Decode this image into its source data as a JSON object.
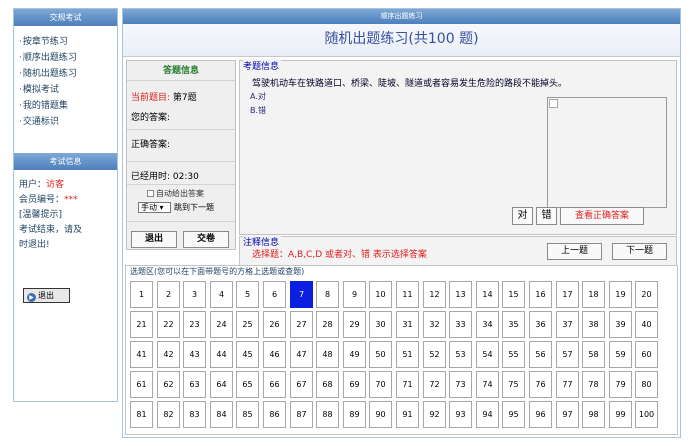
{
  "left": {
    "exam_header": "交规考试",
    "nav_items": [
      {
        "label": "按章节练习"
      },
      {
        "label": "顺序出题练习"
      },
      {
        "label": "随机出题练习"
      },
      {
        "label": "模拟考试"
      },
      {
        "label": "我的错题集"
      },
      {
        "label": "交通标识"
      }
    ],
    "info_header": "考试信息",
    "user_label": "用户：",
    "user_value": "访客",
    "member_label": "会员编号：",
    "member_value": "***",
    "tip_label": "[温馨提示]",
    "tip_text_1": "考试结束，请及",
    "tip_text_2": "时退出!",
    "exit_label": "退出"
  },
  "main": {
    "header": "顺序出题练习",
    "title": "随机出题练习(共100  题)",
    "answer_panel": {
      "title": "答题信息",
      "current_label": "当前题目:",
      "current_value": "第7题",
      "your_answer_label": "您的答案:",
      "your_answer_value": "",
      "correct_label": "正确答案:",
      "correct_value": "",
      "time_label": "已经用时:",
      "time_value": "02:30",
      "auto_answer_label": "自动给出答案",
      "mode_value": "手动",
      "jump_label": "跳到下一题",
      "exit_label": "退出",
      "submit_label": "交卷"
    },
    "question": {
      "label": "考题信息",
      "text": "驾驶机动车在铁路道口、桥梁、陡坡、隧道或者容易发生危险的路段不能掉头。",
      "options": [
        {
          "text": "A.对"
        },
        {
          "text": "B.错"
        }
      ],
      "true_btn": "对",
      "false_btn": "错",
      "show_answer_btn": "查看正确答案"
    },
    "note": {
      "label": "注释信息",
      "text": "选择题：A,B,C,D 或者对、错 表示选择答案",
      "prev_btn": "上一题",
      "next_btn": "下一题"
    },
    "grid": {
      "label": "选题区(您可以在下面带题号的方格上选题或查题)",
      "total": 100,
      "current": 7,
      "columns": 20
    }
  },
  "colors": {
    "header_blue": "#4c7fbd",
    "active_cell": "#0a1fe0",
    "red_text": "#e02020",
    "green_title": "#2c7d35"
  }
}
